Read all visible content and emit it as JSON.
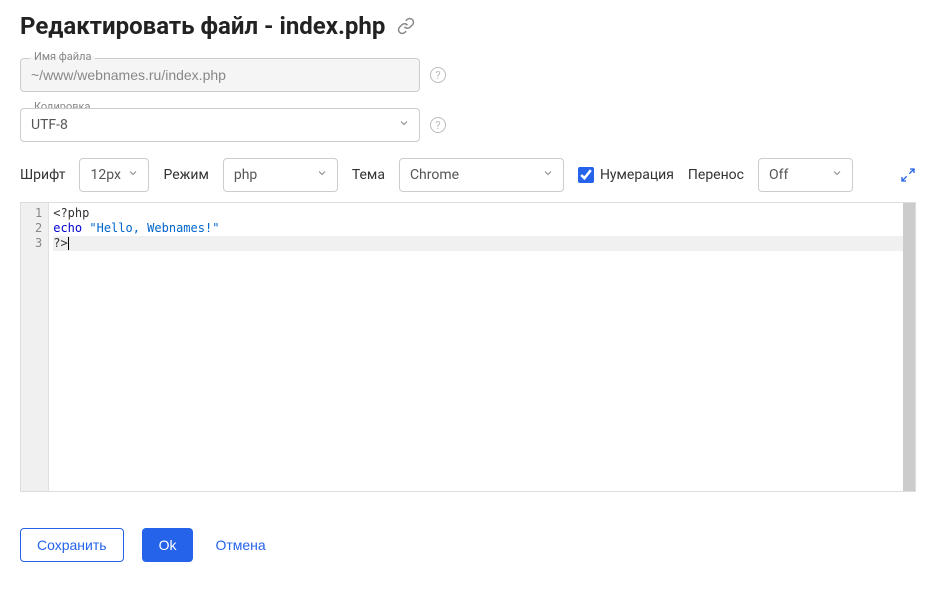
{
  "header": {
    "title": "Редактировать файл - index.php"
  },
  "filename": {
    "label": "Имя файла",
    "value": "~/www/webnames.ru/index.php"
  },
  "encoding": {
    "label": "Кодировка",
    "value": "UTF-8"
  },
  "toolbar": {
    "font_label": "Шрифт",
    "font_value": "12px",
    "mode_label": "Режим",
    "mode_value": "php",
    "theme_label": "Тема",
    "theme_value": "Chrome",
    "numbering_label": "Нумерация",
    "numbering_checked": true,
    "wrap_label": "Перенос",
    "wrap_value": "Off"
  },
  "editor": {
    "lines": [
      {
        "num": "1",
        "tokens": [
          {
            "cls": "",
            "text": "<?php"
          }
        ]
      },
      {
        "num": "2",
        "tokens": [
          {
            "cls": "keyword",
            "text": "echo"
          },
          {
            "cls": "",
            "text": " "
          },
          {
            "cls": "string",
            "text": "\"Hello, Webnames!\""
          }
        ]
      },
      {
        "num": "3",
        "tokens": [
          {
            "cls": "",
            "text": "?>"
          }
        ],
        "active": true
      }
    ]
  },
  "actions": {
    "save": "Сохранить",
    "ok": "Ok",
    "cancel": "Отмена"
  }
}
